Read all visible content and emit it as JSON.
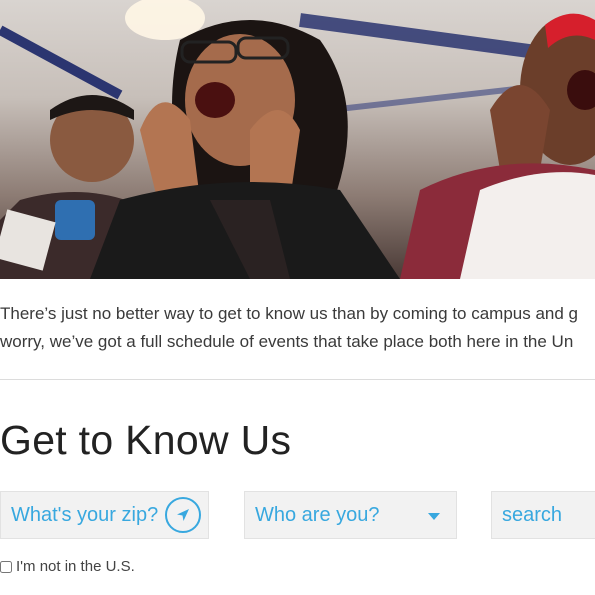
{
  "hero": {
    "image_description": "crowd-cheering-photo"
  },
  "intro": {
    "line1": "There’s just no better way to get to know us than by coming to campus and g",
    "line2": "worry, we’ve got a full schedule of events that take place both here in the Un"
  },
  "section": {
    "title": "Get to Know Us"
  },
  "filters": {
    "zip_placeholder": "What's your zip?",
    "who_placeholder": "Who are you?",
    "search_placeholder": "search",
    "not_in_us_label": "I'm not in the U.S.",
    "not_in_us_checked": false
  },
  "colors": {
    "accent": "#38a8df",
    "field_bg": "#f2f2f2",
    "text": "#333333"
  },
  "icons": {
    "locate": "location-arrow-icon",
    "dropdown": "caret-down-icon"
  }
}
